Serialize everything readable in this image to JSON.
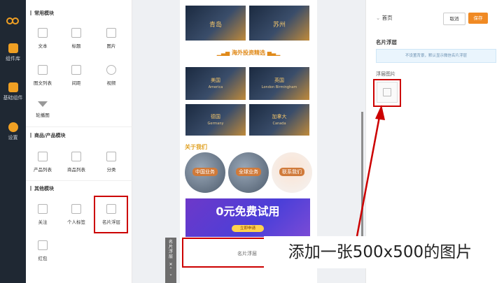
{
  "rail": {
    "items": [
      {
        "label": "组件库"
      },
      {
        "label": "基础组件"
      },
      {
        "label": "设置"
      }
    ]
  },
  "panel": {
    "sections": [
      {
        "title": "常用模块",
        "items": [
          "文本",
          "标题",
          "图片",
          "图文列表",
          "间距",
          "视频",
          "轮播图"
        ]
      },
      {
        "title": "商品/产品模块",
        "items": [
          "产品列表",
          "商品列表",
          "分类"
        ]
      },
      {
        "title": "其他模块",
        "items": [
          "关注",
          "个人标签",
          "名片浮层",
          "红包"
        ]
      }
    ]
  },
  "preview": {
    "top_cities": [
      "青岛",
      "苏州"
    ],
    "section_title": "海外投资精选",
    "countries": [
      {
        "name": "美国",
        "en": "America"
      },
      {
        "name": "英国",
        "en": "London Birmingham"
      },
      {
        "name": "德国",
        "en": "Germany"
      },
      {
        "name": "加拿大",
        "en": "Canada"
      }
    ],
    "about_title": "关于我们",
    "about_items": [
      "中国业务",
      "全球业务",
      "联系我们"
    ],
    "banner_text": "0元免费试用",
    "banner_sub": "立即申请",
    "card_float_label": "名片浮层",
    "side_label": "名片浮层"
  },
  "props": {
    "breadcrumb": "首页",
    "cancel_label": "取消",
    "save_label": "保存",
    "section_title": "名片浮层",
    "info_text": "不设置背景，默认显示微信名片浮层",
    "image_label": "浮层图片"
  },
  "callout": {
    "text": "添加一张500x500的图片"
  },
  "colors": {
    "rail_bg": "#1f2833",
    "accent": "#f0a023",
    "highlight_red": "#cc0000",
    "save_button": "#f08a24"
  }
}
